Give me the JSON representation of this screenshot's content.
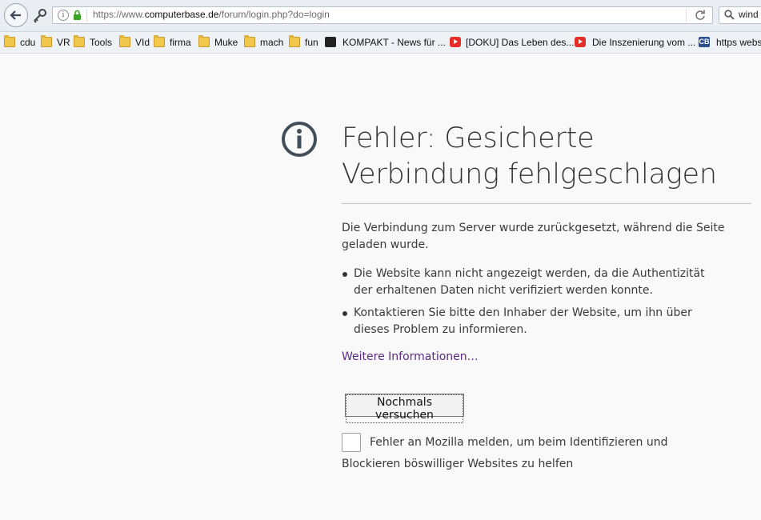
{
  "browser": {
    "url_prefix": "https://www.",
    "url_domain": "computerbase.de",
    "url_path": "/forum/login.php?do=login",
    "search_text": "wind"
  },
  "bookmarks": [
    {
      "label": "cdu",
      "icon": "folder-icon"
    },
    {
      "label": "VR",
      "icon": "folder-icon"
    },
    {
      "label": "Tools",
      "icon": "folder-icon"
    },
    {
      "label": "VId",
      "icon": "folder-icon"
    },
    {
      "label": "firma",
      "icon": "folder-icon"
    },
    {
      "label": "Muke",
      "icon": "folder-icon"
    },
    {
      "label": "mach",
      "icon": "folder-icon"
    },
    {
      "label": "fun",
      "icon": "folder-icon"
    },
    {
      "label": "KOMPAKT - News für ...",
      "icon": "kompakt-icon"
    },
    {
      "label": "[DOKU] Das Leben des...",
      "icon": "youtube-icon"
    },
    {
      "label": "Die Inszenierung vom ...",
      "icon": "youtube-icon"
    },
    {
      "label": "https webs",
      "icon": "computerbase-icon"
    }
  ],
  "error": {
    "title": "Fehler: Gesicherte Verbindung fehlgeschlagen",
    "description": "Die Verbindung zum Server wurde zurückgesetzt, während die Seite geladen wurde.",
    "bullets": [
      "Die Website kann nicht angezeigt werden, da die Authentizität der erhaltenen Daten nicht verifiziert werden konnte.",
      "Kontaktieren Sie bitte den Inhaber der Website, um ihn über dieses Problem zu informieren."
    ],
    "more_info": "Weitere Informationen…",
    "retry_label": "Nochmals versuchen",
    "report_label": "Fehler an Mozilla melden, um beim Identifizieren und Blockieren böswilliger Websites zu helfen"
  },
  "colors": {
    "link": "#5a2a82",
    "background": "#f9f9fa"
  }
}
